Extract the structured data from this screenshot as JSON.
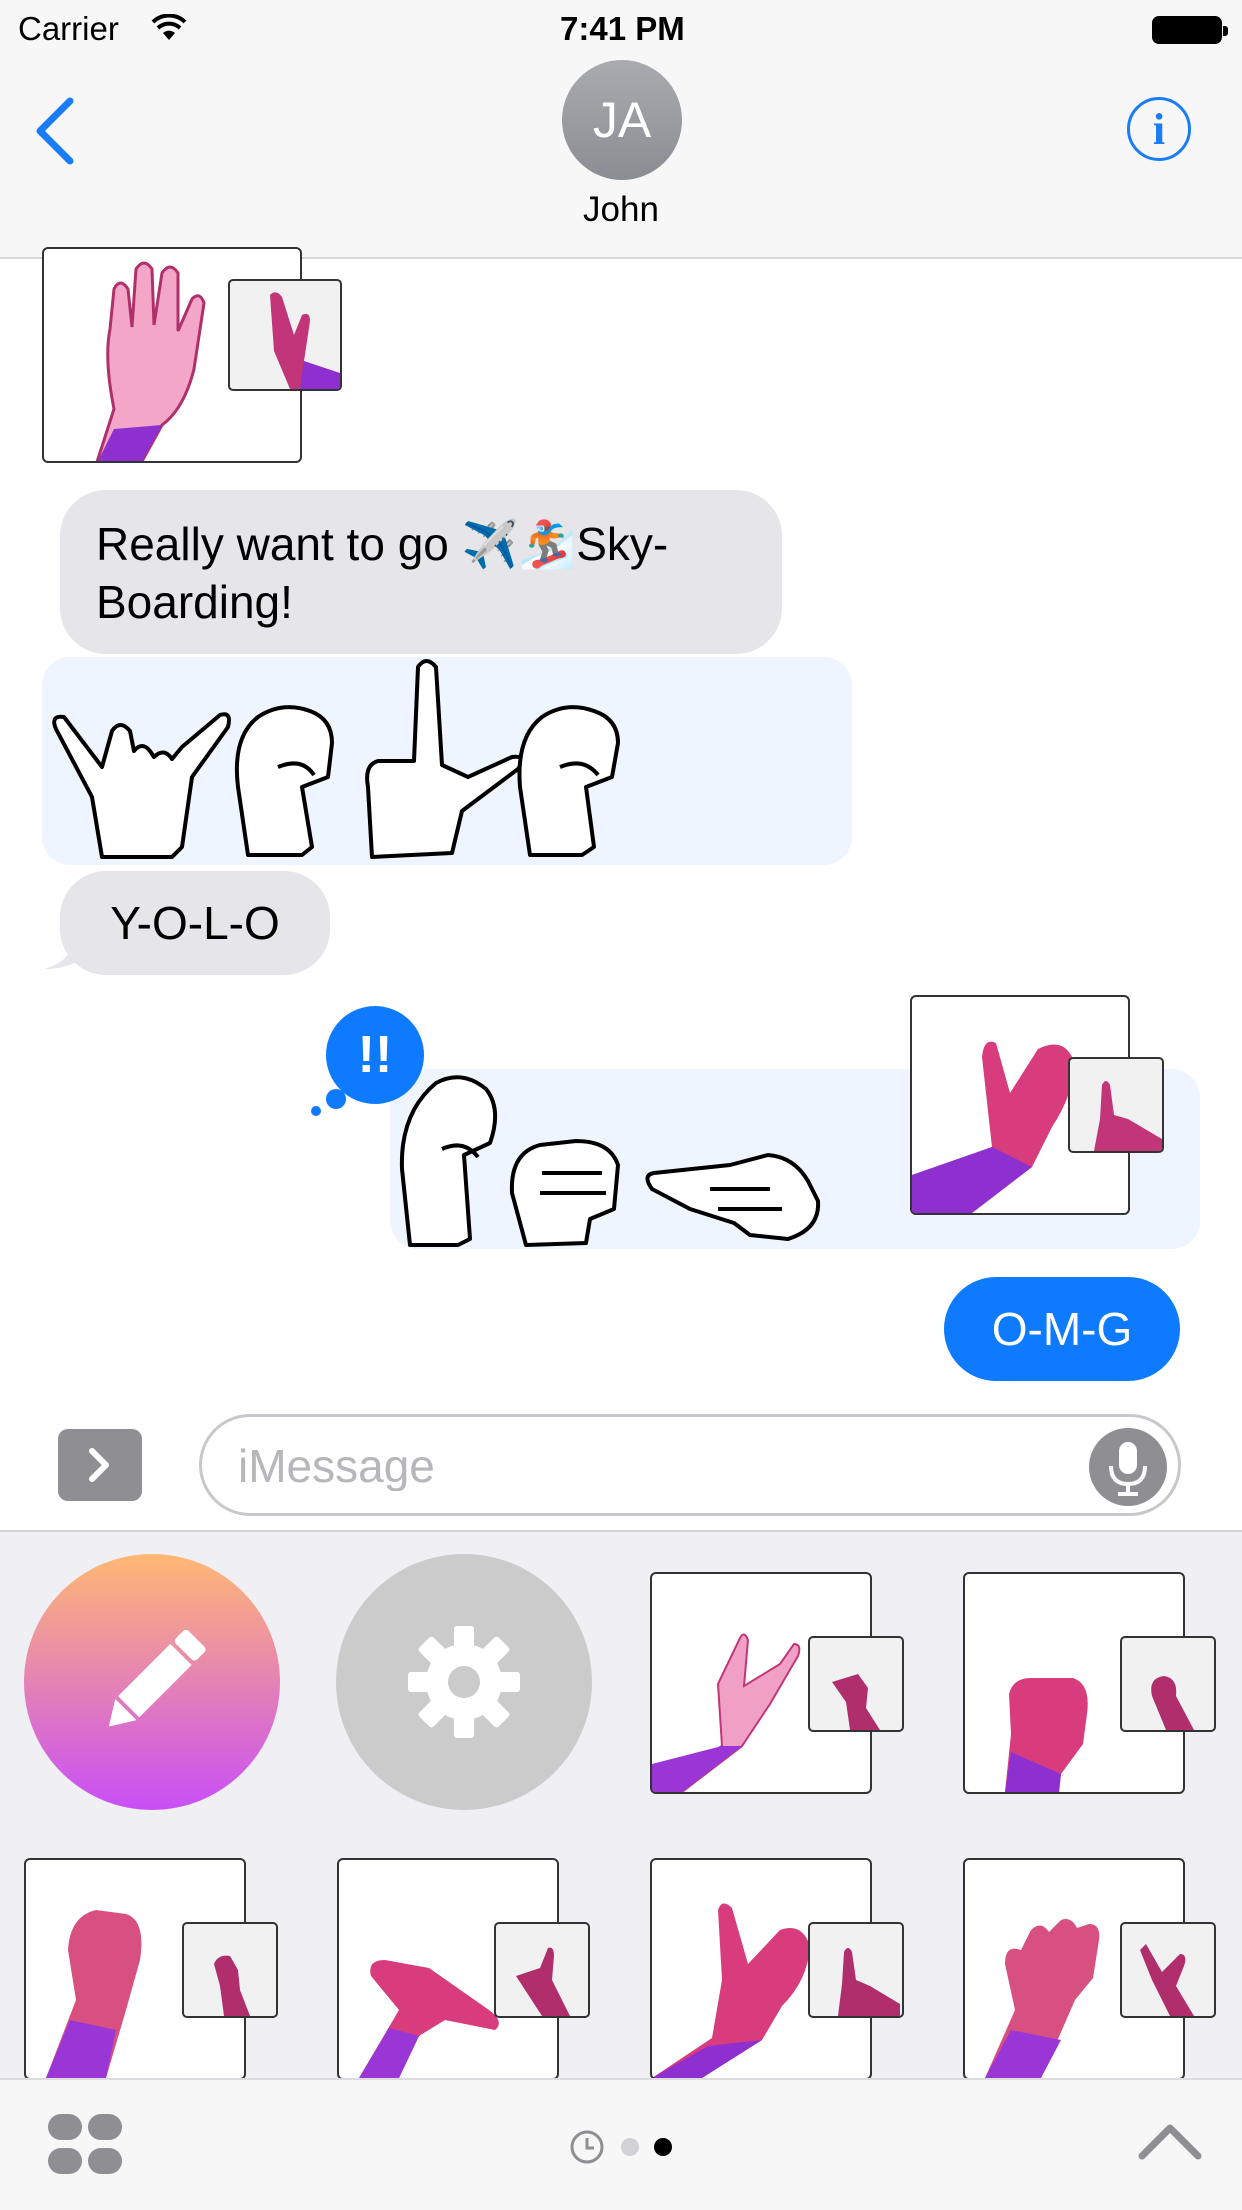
{
  "status_bar": {
    "carrier": "Carrier",
    "time": "7:41 PM"
  },
  "header": {
    "avatar_initials": "JA",
    "contact_name": "John"
  },
  "messages": {
    "bubble1": {
      "line1": "Really want to go ✈️🏂Sky-",
      "line2": "Boarding!"
    },
    "bubble2": "Y-O-L-O",
    "bubble3": "O-M-G",
    "effect_badge": "!!"
  },
  "input": {
    "placeholder": "iMessage"
  },
  "colors": {
    "accent": "#0d7aff",
    "incoming_bubble": "#e5e5ea",
    "sign_panel": "#eff5fe",
    "hand_pink": "#e04a8a",
    "hand_purple": "#8e2fd0"
  },
  "icons": [
    "back-chevron-icon",
    "info-icon",
    "wifi-icon",
    "battery-icon",
    "apps-chevron-icon",
    "mic-icon",
    "pencil-icon",
    "gear-icon",
    "grid-icon",
    "clock-icon",
    "chevron-up-icon"
  ]
}
